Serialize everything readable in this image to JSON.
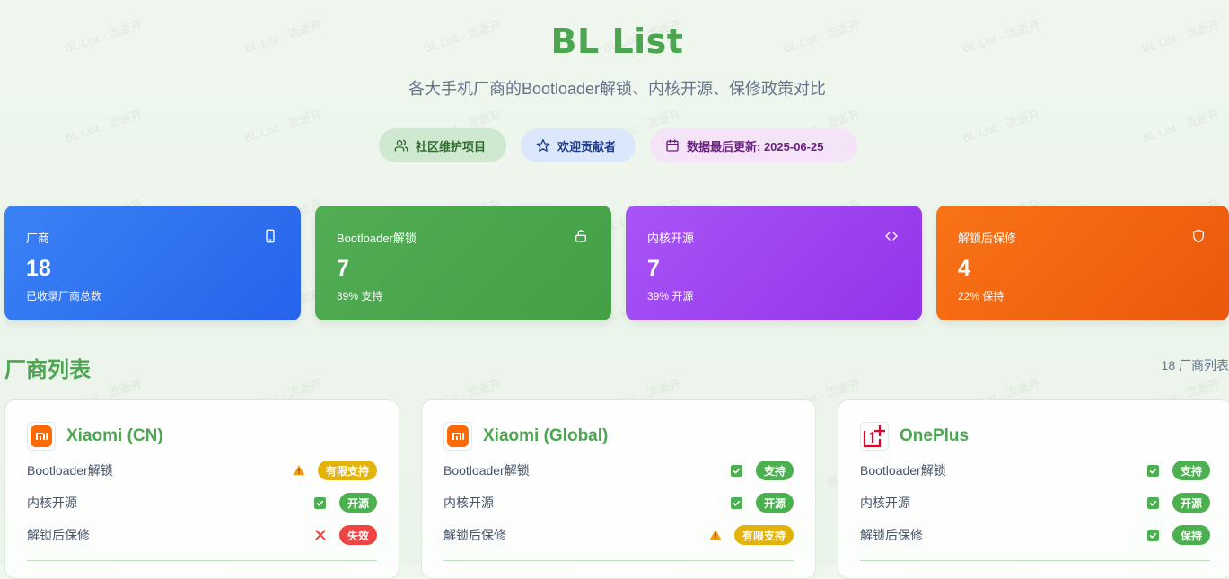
{
  "header": {
    "title": "BL List",
    "subtitle": "各大手机厂商的Bootloader解锁、内核开源、保修政策对比",
    "watermark": "BL List - 流逝开"
  },
  "pills": [
    {
      "label": "社区维护项目",
      "icon": "users-icon"
    },
    {
      "label": "欢迎贡献者",
      "icon": "star-icon"
    },
    {
      "label": "数据最后更新: 2025-06-25",
      "icon": "calendar-icon"
    }
  ],
  "stats": [
    {
      "label": "厂商",
      "value": "18",
      "sub": "已收录厂商总数",
      "icon": "phone-icon",
      "color": "#3b82f6"
    },
    {
      "label": "Bootloader解锁",
      "value": "7",
      "sub": "39% 支持",
      "icon": "unlock-icon",
      "color": "#4caf50"
    },
    {
      "label": "内核开源",
      "value": "7",
      "sub": "39% 开源",
      "icon": "code-icon",
      "color": "#a855f7"
    },
    {
      "label": "解锁后保修",
      "value": "4",
      "sub": "22% 保持",
      "icon": "shield-icon",
      "color": "#f97316"
    }
  ],
  "section": {
    "title": "厂商列表",
    "count": "18 厂商列表"
  },
  "vendors": [
    {
      "name": "Xiaomi (CN)",
      "logo": "xiaomi-logo",
      "rows": [
        {
          "label": "Bootloader解锁",
          "badge": "有限支持",
          "status": "warning"
        },
        {
          "label": "内核开源",
          "badge": "开源",
          "status": "ok"
        },
        {
          "label": "解锁后保修",
          "badge": "失效",
          "status": "fail"
        }
      ]
    },
    {
      "name": "Xiaomi (Global)",
      "logo": "xiaomi-logo",
      "rows": [
        {
          "label": "Bootloader解锁",
          "badge": "支持",
          "status": "ok"
        },
        {
          "label": "内核开源",
          "badge": "开源",
          "status": "ok"
        },
        {
          "label": "解锁后保修",
          "badge": "有限支持",
          "status": "warning"
        }
      ]
    },
    {
      "name": "OnePlus",
      "logo": "oneplus-logo",
      "rows": [
        {
          "label": "Bootloader解锁",
          "badge": "支持",
          "status": "ok"
        },
        {
          "label": "内核开源",
          "badge": "开源",
          "status": "ok"
        },
        {
          "label": "解锁后保修",
          "badge": "保持",
          "status": "ok"
        }
      ]
    }
  ],
  "colors": {
    "brand_green": "#4ca64f",
    "badge_green": "#4caf50",
    "badge_yellow": "#e4b30b",
    "badge_red": "#ef4444"
  }
}
